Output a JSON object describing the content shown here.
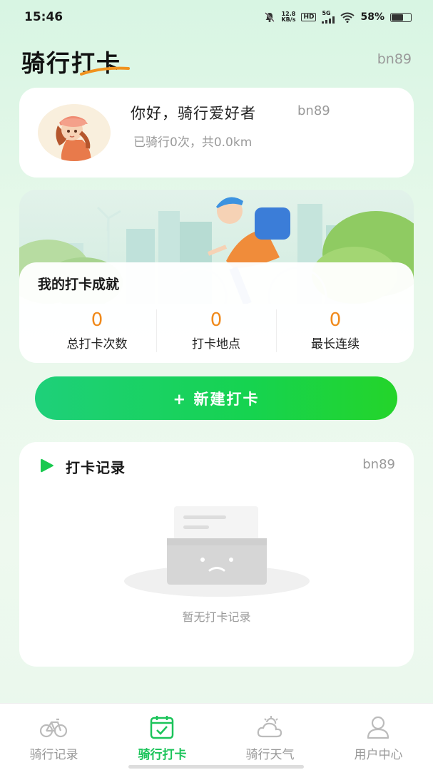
{
  "status_bar": {
    "time": "15:46",
    "net_speed_top": "12.8",
    "net_speed_bottom": "KB/s",
    "hd": "HD",
    "signal": "5G",
    "battery": "58%"
  },
  "header": {
    "title": "骑行打卡",
    "user": "bn89"
  },
  "profile": {
    "greeting": "你好，骑行爱好者",
    "user": "bn89",
    "summary": "已骑行0次，共0.0km"
  },
  "achievements": {
    "title": "我的打卡成就",
    "stats": [
      {
        "value": "0",
        "label": "总打卡次数"
      },
      {
        "value": "0",
        "label": "打卡地点"
      },
      {
        "value": "0",
        "label": "最长连续"
      }
    ]
  },
  "new_checkin": {
    "label": "+ 新建打卡"
  },
  "records": {
    "title": "打卡记录",
    "user": "bn89",
    "empty_text": "暂无打卡记录"
  },
  "nav": {
    "items": [
      {
        "label": "骑行记录",
        "icon": "bike-icon"
      },
      {
        "label": "骑行打卡",
        "icon": "calendar-check-icon",
        "active": true
      },
      {
        "label": "骑行天气",
        "icon": "weather-icon"
      },
      {
        "label": "用户中心",
        "icon": "user-icon"
      }
    ]
  },
  "colors": {
    "accent": "#1bc45a",
    "stat_value": "#f08a1c"
  }
}
